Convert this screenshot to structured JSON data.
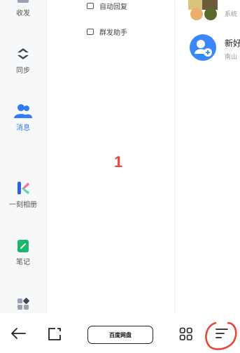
{
  "sidebar": {
    "items": [
      {
        "label": "收发",
        "icon": "inbox-icon"
      },
      {
        "label": "同步",
        "icon": "sync-icon"
      },
      {
        "label": "消息",
        "icon": "contacts-icon"
      },
      {
        "label": "一刻相册",
        "icon": "album-icon"
      },
      {
        "label": "笔记",
        "icon": "note-icon"
      },
      {
        "label": "",
        "icon": "apps-grid-icon"
      }
    ]
  },
  "menu": {
    "items": [
      {
        "label": "自动回复",
        "icon": "auto-reply-icon"
      },
      {
        "label": "群发助手",
        "icon": "broadcast-icon"
      }
    ]
  },
  "main": {
    "annotation_number": "1"
  },
  "contacts": [
    {
      "name": "",
      "sub": "系统"
    },
    {
      "name": "新好",
      "sub": "南山"
    }
  ],
  "bottom_nav": {
    "center_label": "百度网盘",
    "icons": [
      "back-arrow-icon",
      "window-icon",
      "apps-icon",
      "menu-lines-icon"
    ]
  },
  "colors": {
    "accent": "#3a7bfd",
    "annotation_red": "#e8463c"
  }
}
